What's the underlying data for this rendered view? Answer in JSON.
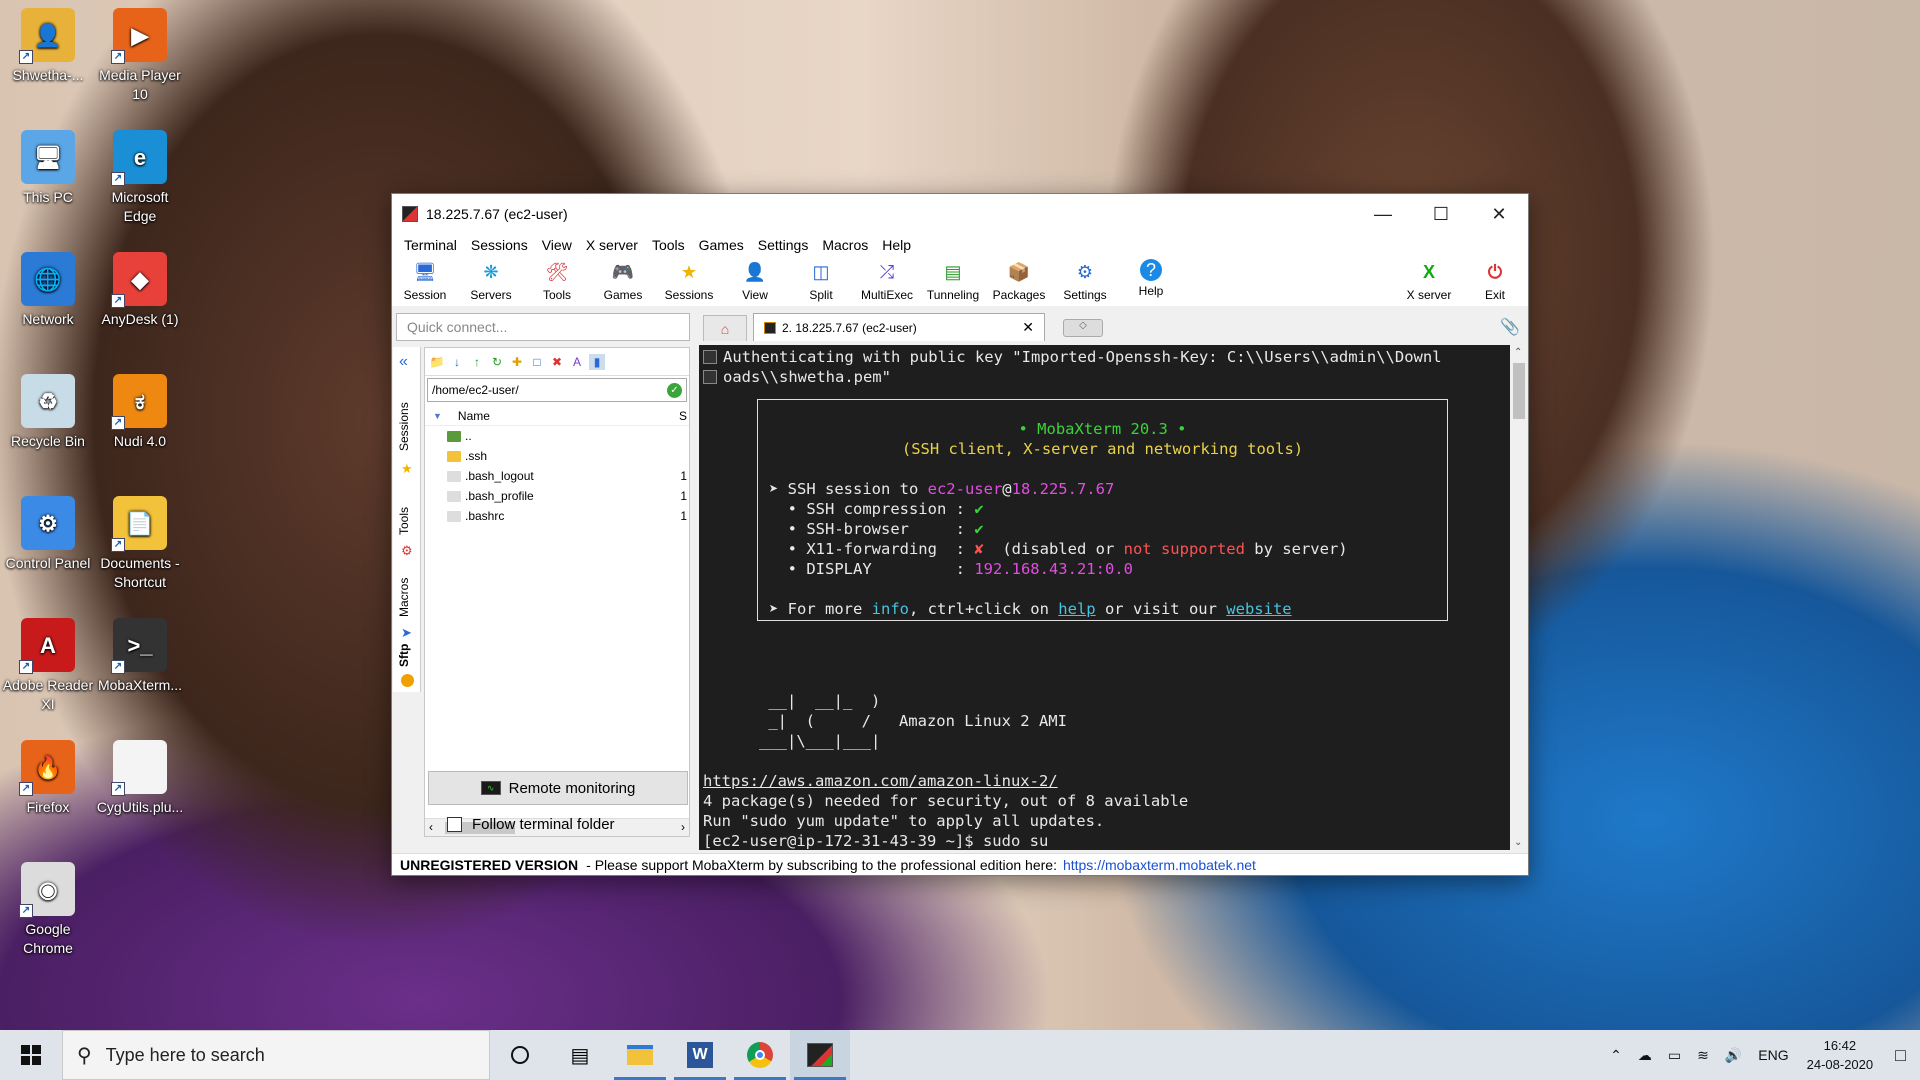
{
  "desktop": {
    "icons": [
      {
        "label": "Shwetha-...",
        "icon": "user-folder-icon"
      },
      {
        "label": "Media Player 10",
        "icon": "media-player-icon"
      },
      {
        "label": "This PC",
        "icon": "computer-icon"
      },
      {
        "label": "Microsoft Edge",
        "icon": "edge-icon"
      },
      {
        "label": "Network",
        "icon": "network-icon"
      },
      {
        "label": "AnyDesk (1)",
        "icon": "anydesk-icon"
      },
      {
        "label": "Recycle Bin",
        "icon": "recycle-bin-icon"
      },
      {
        "label": "Nudi 4.0",
        "icon": "nudi-icon"
      },
      {
        "label": "Control Panel",
        "icon": "control-panel-icon"
      },
      {
        "label": "Documents - Shortcut",
        "icon": "documents-folder-icon"
      },
      {
        "label": "Adobe Reader XI",
        "icon": "adobe-reader-icon"
      },
      {
        "label": "MobaXterm...",
        "icon": "mobaxterm-icon"
      },
      {
        "label": "Firefox",
        "icon": "firefox-icon"
      },
      {
        "label": "CygUtils.plu...",
        "icon": "file-icon"
      },
      {
        "label": "Google Chrome",
        "icon": "chrome-icon"
      }
    ]
  },
  "window": {
    "title": "18.225.7.67 (ec2-user)",
    "menu": [
      "Terminal",
      "Sessions",
      "View",
      "X server",
      "Tools",
      "Games",
      "Settings",
      "Macros",
      "Help"
    ],
    "toolbar": [
      "Session",
      "Servers",
      "Tools",
      "Games",
      "Sessions",
      "View",
      "Split",
      "MultiExec",
      "Tunneling",
      "Packages",
      "Settings",
      "Help"
    ],
    "toolbar_right": [
      "X server",
      "Exit"
    ],
    "quick_connect_placeholder": "Quick connect...",
    "tab_label": "2. 18.225.7.67 (ec2-user)",
    "side_tabs": [
      "Sessions",
      "Tools",
      "Macros",
      "Sftp"
    ],
    "sftp": {
      "path": "/home/ec2-user/",
      "col_name": "Name",
      "col_size": "S",
      "files": [
        {
          "name": "..",
          "size": ""
        },
        {
          "name": ".ssh",
          "size": ""
        },
        {
          "name": ".bash_logout",
          "size": "1"
        },
        {
          "name": ".bash_profile",
          "size": "1"
        },
        {
          "name": ".bashrc",
          "size": "1"
        }
      ],
      "remote_monitoring": "Remote monitoring",
      "follow_terminal": "Follow terminal folder"
    },
    "terminal": {
      "auth_line1": "Authenticating with public key \"Imported-Openssh-Key: C:\\\\Users\\\\admin\\\\Downl",
      "auth_line2": "oads\\\\shwetha.pem\"",
      "banner_title": "• MobaXterm 20.3 •",
      "banner_sub": "(SSH client, X-server and networking tools)",
      "ssh_session_prefix": "➤ SSH session to ",
      "ssh_user": "ec2-user",
      "ssh_at": "@",
      "ssh_host": "18.225.7.67",
      "compression_label": "  • SSH compression : ",
      "browser_label": "  • SSH-browser     : ",
      "x11_label": "  • X11-forwarding  : ",
      "x11_note_a": "  (disabled ",
      "x11_note_or": "or",
      "x11_note_b": " not supported",
      "x11_note_c": " by server)",
      "display_label": "  • DISPLAY         : ",
      "display_value": "192.168.43.21:0.0",
      "more_a": "➤ For more ",
      "more_info": "info",
      "more_b": ", ctrl+click on ",
      "more_help": "help",
      "more_c": " or visit our ",
      "more_site": "website",
      "art1": "       __|  __|_  )",
      "art2": "       _|  (     /   Amazon Linux 2 AMI",
      "art3": "      ___|\\___|___|",
      "url": "https://aws.amazon.com/amazon-linux-2/",
      "pkg_line": "4 package(s) needed for security, out of 8 available",
      "run_line": "Run \"sudo yum update\" to apply all updates.",
      "prompt_line": "[ec2-user@ip-172-31-43-39 ~]$ sudo su"
    },
    "status": {
      "unregistered": "UNREGISTERED VERSION",
      "message": "-  Please support MobaXterm by subscribing to the professional edition here:",
      "url": "https://mobaxterm.mobatek.net"
    }
  },
  "taskbar": {
    "search_placeholder": "Type here to search",
    "lang": "ENG",
    "time": "16:42",
    "date": "24-08-2020"
  }
}
